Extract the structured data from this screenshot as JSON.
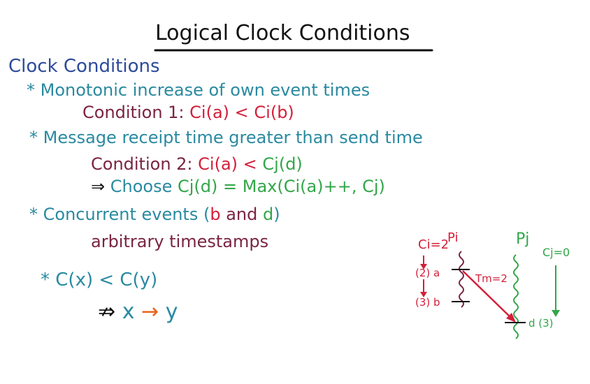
{
  "title": "Logical Clock Conditions",
  "heading": "Clock Conditions",
  "bullet1": "* Monotonic increase of own event times",
  "cond1": {
    "label": "Condition 1:",
    "lhs": "Ci(a)",
    "op": "<",
    "rhs": "Ci(b)"
  },
  "bullet2": "* Message receipt time greater than send time",
  "cond2": {
    "label": "Condition 2:",
    "lhs": "Ci(a)",
    "op": "<",
    "rhs": "Cj(d)"
  },
  "choose": {
    "arrow": "⇒",
    "word": "Choose",
    "expr": "Cj(d) = Max(",
    "args": "Ci(a)++, Cj)"
  },
  "bullet3": {
    "text": "* Concurrent events (",
    "b": "b",
    "and": "and",
    "d": "d",
    "close": ")"
  },
  "arbitrary": "arbitrary timestamps",
  "bullet4": "* C(x) < C(y)",
  "implies": {
    "not_arrow": "⇏",
    "x": "x",
    "arrow": "→",
    "y": "y"
  },
  "diagram": {
    "ci_label": "Ci=2",
    "pi_label": "Pi",
    "pj_label": "Pj",
    "cj_label": "Cj=0",
    "event_a": "(2) a",
    "event_b": "(3) b",
    "tm_label": "Tm=2",
    "event_d": "d (3)"
  },
  "colors": {
    "plum": "#7a2443",
    "red": "#d41f3a",
    "green": "#33a64a",
    "teal": "#2a8aa0",
    "navy": "#2c4b9a",
    "orange": "#e8651c"
  }
}
